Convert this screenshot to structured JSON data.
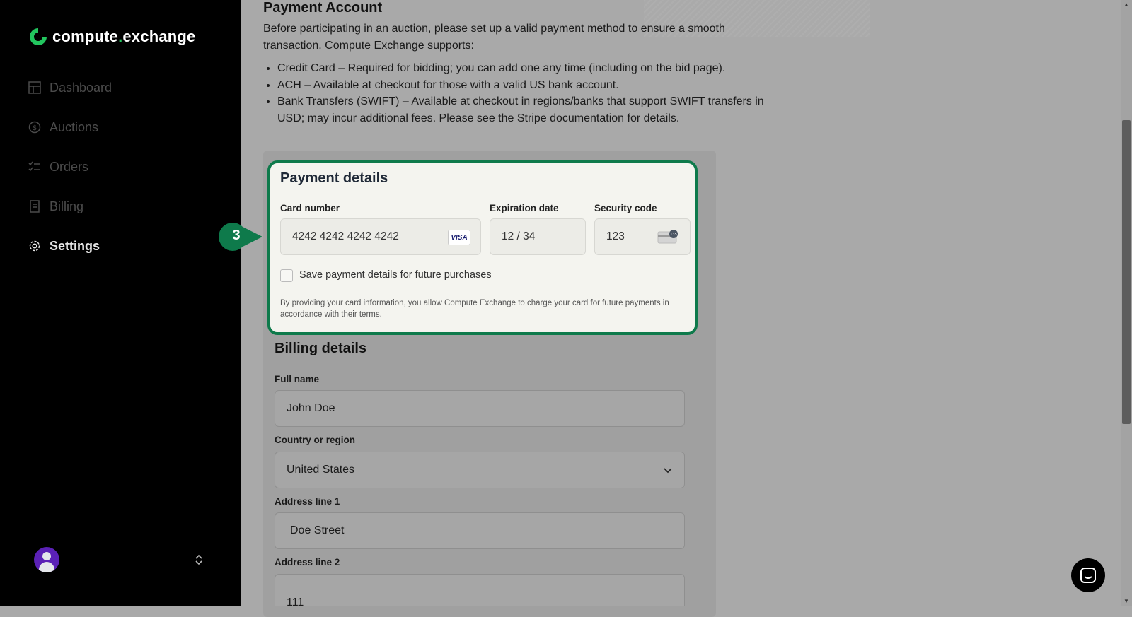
{
  "app": {
    "logo_text_part1": "compute",
    "logo_dot": ".",
    "logo_text_part2": "exchange",
    "brand_color": "#22c55e"
  },
  "sidebar": {
    "items": [
      {
        "label": "Dashboard",
        "icon": "grid-icon",
        "active": false
      },
      {
        "label": "Auctions",
        "icon": "dollar-circle-icon",
        "active": false
      },
      {
        "label": "Orders",
        "icon": "checklist-icon",
        "active": false
      },
      {
        "label": "Billing",
        "icon": "receipt-icon",
        "active": false
      },
      {
        "label": "Settings",
        "icon": "gear-icon",
        "active": true
      }
    ],
    "user_avatar": "user-avatar-icon",
    "switcher_icon": "chevron-up-down-icon"
  },
  "main": {
    "title": "Payment Account",
    "intro": "Before participating in an auction, please set up a valid payment method to ensure a smooth transaction. Compute Exchange supports:",
    "bullets": [
      "Credit Card – Required for bidding; you can add one any time (including on the bid page).",
      "ACH – Available at checkout for those with a valid US bank account.",
      "Bank Transfers (SWIFT) – Available at checkout in regions/banks that support SWIFT transfers in USD; may incur additional fees. Please see the Stripe documentation for details."
    ]
  },
  "payment": {
    "title": "Payment details",
    "card_number_label": "Card number",
    "card_number_value": "4242 4242 4242 4242",
    "card_brand": "VISA",
    "expiration_label": "Expiration date",
    "expiration_value": "12 / 34",
    "security_label": "Security code",
    "security_value": "123",
    "cvc_badge": "135",
    "save_label": "Save payment details for future purchases",
    "save_checked": false,
    "terms": "By providing your card information, you allow Compute Exchange to charge your card for future payments in accordance with their terms.",
    "highlight_color": "#0e7a4b"
  },
  "step_marker": {
    "number": "3"
  },
  "billing": {
    "title": "Billing details",
    "full_name_label": "Full name",
    "full_name_value": "John Doe",
    "country_label": "Country or region",
    "country_value": "United States",
    "address1_label": "Address line 1",
    "address1_value": "Doe Street",
    "address2_label": "Address line 2",
    "address2_value": "111"
  }
}
